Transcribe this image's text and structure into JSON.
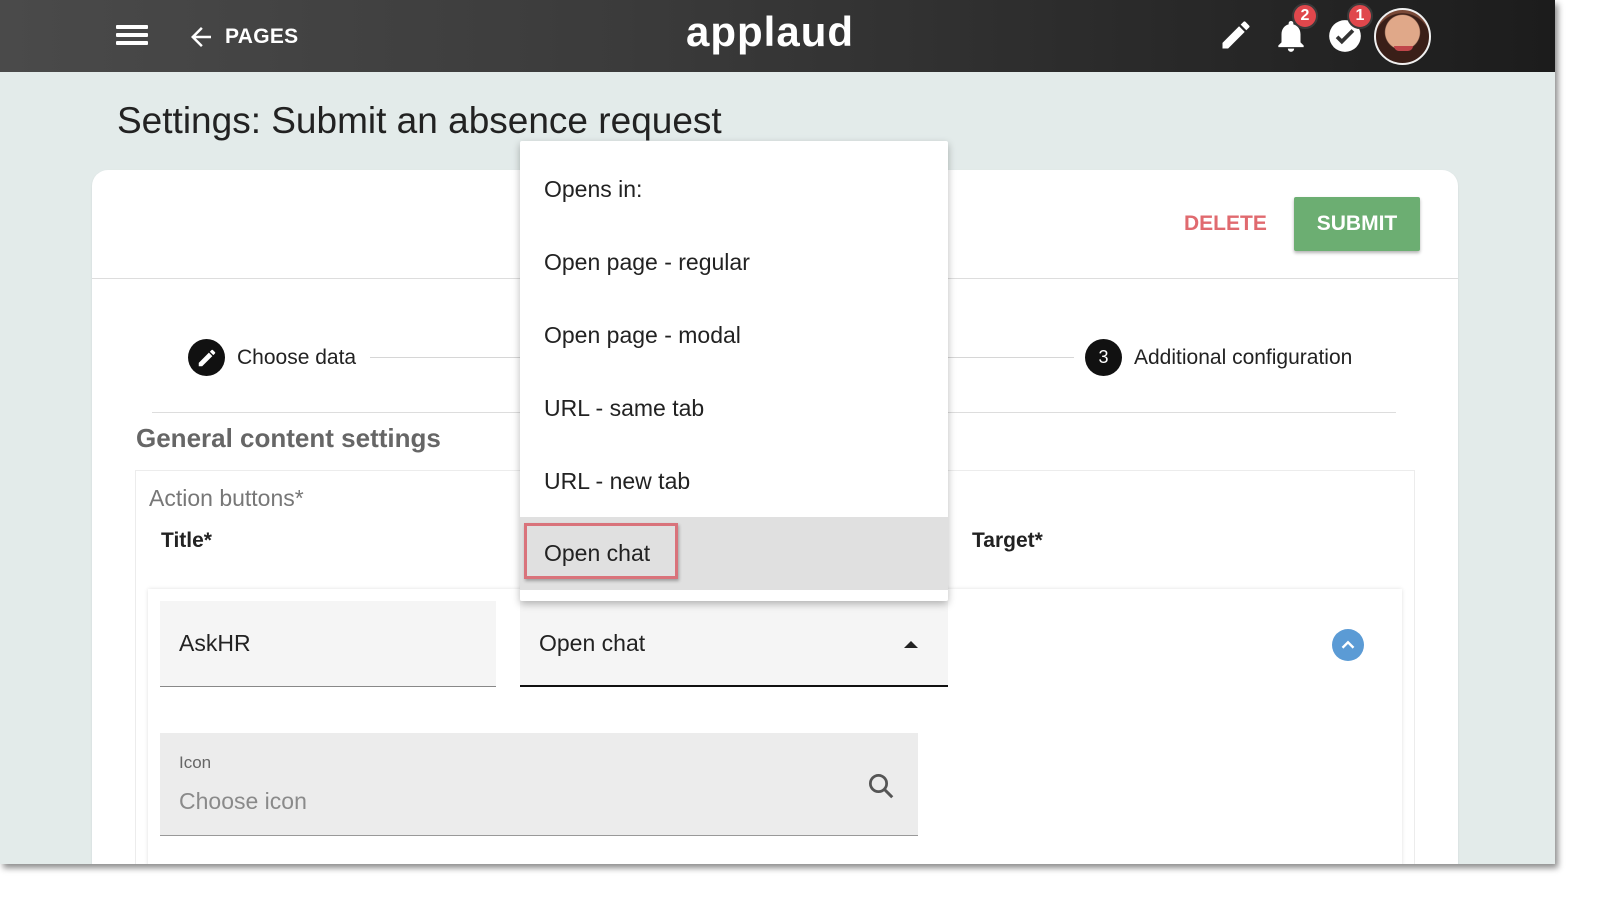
{
  "topbar": {
    "back_label": "PAGES",
    "logo": "applaud",
    "notifications_badge": "2",
    "tasks_badge": "1",
    "icons": [
      "menu-icon",
      "arrow-left-icon",
      "pencil-icon",
      "bell-icon",
      "check-circle-icon"
    ]
  },
  "page": {
    "title": "Settings: Submit an absence request"
  },
  "actions": {
    "delete_label": "DELETE",
    "submit_label": "SUBMIT"
  },
  "stepper": {
    "step1_label": "Choose data",
    "step3_number": "3",
    "step3_label": "Additional configuration"
  },
  "section": {
    "title": "General content settings",
    "action_buttons_label": "Action buttons*",
    "col_title": "Title*",
    "col_target": "Target*"
  },
  "row": {
    "title_value": "AskHR",
    "opens_in_value": "Open chat",
    "icon_label": "Icon",
    "icon_placeholder": "Choose icon"
  },
  "dropdown": {
    "options": [
      "Opens in:",
      "Open page - regular",
      "Open page - modal",
      "URL - same tab",
      "URL - new tab",
      "Open chat"
    ],
    "selected": "Open chat"
  },
  "colors": {
    "submit": "#6cae72",
    "delete": "#e06a6f",
    "badge": "#e0474c",
    "accent_blue": "#5b9bd5",
    "highlight": "#d9737b"
  }
}
